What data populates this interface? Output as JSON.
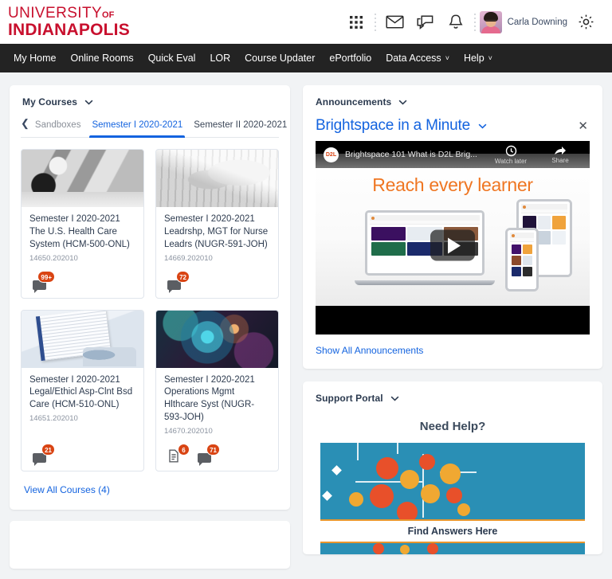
{
  "brand": {
    "line1": "UNIVERSITY",
    "line1_small": "OF",
    "line2": "INDIANAPOLIS",
    "color": "#c8102e"
  },
  "header": {
    "icons": [
      {
        "name": "waffle-grid-icon",
        "label": "Course Selector"
      },
      {
        "name": "envelope-icon",
        "label": "Email"
      },
      {
        "name": "chat-bubble-icon",
        "label": "Subscriptions"
      },
      {
        "name": "bell-icon",
        "label": "Notifications"
      },
      {
        "name": "gear-icon",
        "label": "Settings"
      }
    ],
    "user_name": "Carla Downing"
  },
  "nav": {
    "items": [
      {
        "label": "My Home",
        "has_caret": false
      },
      {
        "label": "Online Rooms",
        "has_caret": false
      },
      {
        "label": "Quick Eval",
        "has_caret": false
      },
      {
        "label": "LOR",
        "has_caret": false
      },
      {
        "label": "Course Updater",
        "has_caret": false
      },
      {
        "label": "ePortfolio",
        "has_caret": false
      },
      {
        "label": "Data Access",
        "has_caret": true
      },
      {
        "label": "Help",
        "has_caret": true
      }
    ],
    "caret_glyph": "˅",
    "background": "#232323"
  },
  "my_courses": {
    "title": "My Courses",
    "tabs": [
      {
        "label": "Sandboxes",
        "active": false
      },
      {
        "label": "Semester I 2020-2021",
        "active": true
      },
      {
        "label": "Semester II 2020-2021",
        "active": false
      }
    ],
    "active_color": "#1363df",
    "courses": [
      {
        "semester": "Semester I 2020-2021",
        "name": "The U.S. Health Care System (HCM-500-ONL)",
        "code": "14650.202010",
        "image": "stethoscope-grayscale",
        "badges": [
          {
            "icon": "chat-bubble-icon",
            "count": "99+"
          }
        ]
      },
      {
        "semester": "Semester I 2020-2021",
        "name": "Leadrshp, MGT for Nurse Leadrs (NUGR-591-JOH)",
        "code": "14669.202010",
        "image": "hands-keyboard-grayscale",
        "badges": [
          {
            "icon": "chat-bubble-icon",
            "count": "72"
          }
        ]
      },
      {
        "semester": "Semester I 2020-2021",
        "name": "Legal/Ethicl Asp-Clnt Bsd Care (HCM-510-ONL)",
        "code": "14651.202010",
        "image": "clipboard-medical",
        "badges": [
          {
            "icon": "chat-bubble-icon",
            "count": "21"
          }
        ]
      },
      {
        "semester": "Semester I 2020-2021",
        "name": "Operations Mgmt Hlthcare Syst (NUGR-593-JOH)",
        "code": "14670.202010",
        "image": "nebula-space",
        "badges": [
          {
            "icon": "document-icon",
            "count": "6"
          },
          {
            "icon": "chat-bubble-icon",
            "count": "71"
          }
        ]
      }
    ],
    "view_all_label": "View All Courses (4)"
  },
  "announcements": {
    "widget_title": "Announcements",
    "headline": "Brightspace in a Minute",
    "close_glyph": "✕",
    "video": {
      "channel_badge": "D2L",
      "title": "Brightspace 101 What is D2L Brig...",
      "watch_later_label": "Watch later",
      "share_label": "Share",
      "tagline": "Reach every learner"
    },
    "show_all_label": "Show All Announcements"
  },
  "support_portal": {
    "widget_title": "Support Portal",
    "need_help": "Need Help?",
    "find_answers": "Find Answers Here",
    "accent_color": "#e8962c",
    "image_background": "#2a8fb5"
  }
}
